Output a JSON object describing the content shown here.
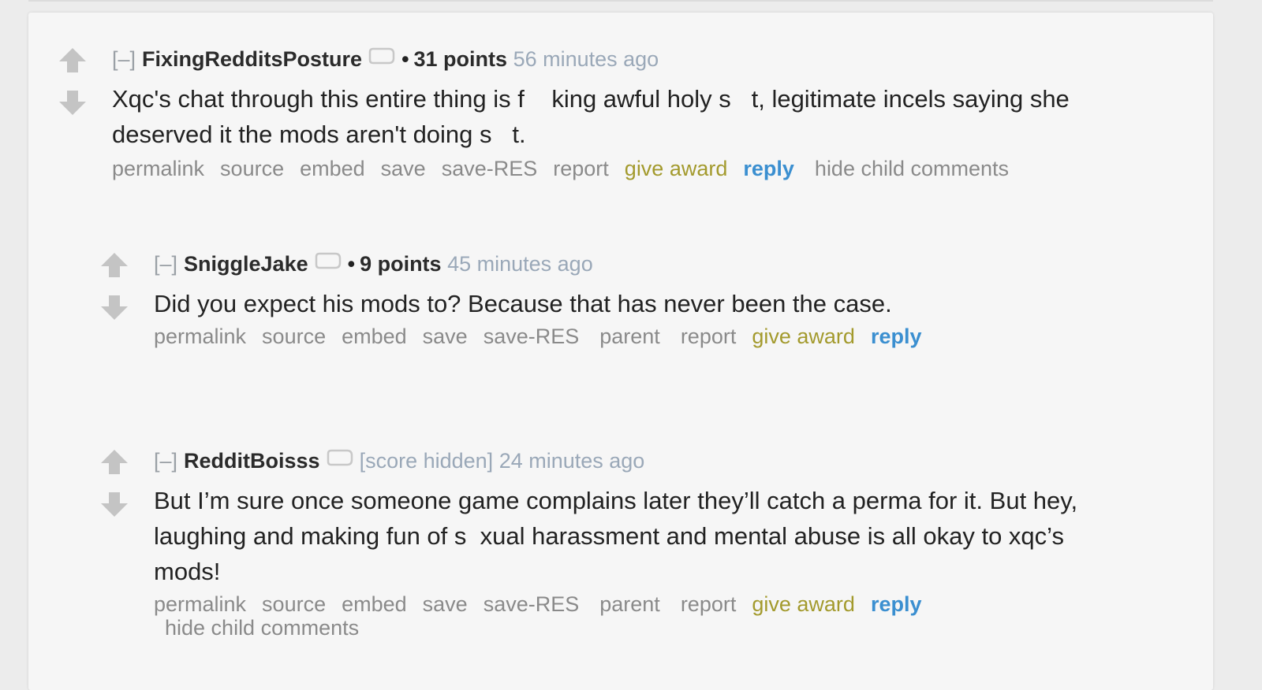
{
  "comments": [
    {
      "expand": "[–]",
      "author": "FixingRedditsPosture",
      "bullet": "•",
      "score": "31 points",
      "time": "56 minutes ago",
      "body": "Xqc's chat through this entire thing is f    king awful holy s   t, legitimate incels saying she deserved it the mods aren't doing s   t.",
      "buttons": {
        "permalink": "permalink",
        "source": "source",
        "embed": "embed",
        "save": "save",
        "save_res": "save-RES",
        "report": "report",
        "give_award": "give award",
        "reply": "reply",
        "hide_child": "hide child comments"
      }
    },
    {
      "expand": "[–]",
      "author": "SniggleJake",
      "bullet": "•",
      "score": "9 points",
      "time": "45 minutes ago",
      "body": "Did you expect his mods to? Because that has never been the case.",
      "buttons": {
        "permalink": "permalink",
        "source": "source",
        "embed": "embed",
        "save": "save",
        "save_res": "save-RES",
        "parent": "parent",
        "report": "report",
        "give_award": "give award",
        "reply": "reply"
      }
    },
    {
      "expand": "[–]",
      "author": "RedditBoisss",
      "score_hidden": "[score hidden]",
      "time": "24 minutes ago",
      "body": "But I’m sure once someone game complains later they’ll catch a perma for it. But hey, laughing and making fun of s  xual harassment and mental abuse is all okay to xqc’s mods!",
      "buttons": {
        "permalink": "permalink",
        "source": "source",
        "embed": "embed",
        "save": "save",
        "save_res": "save-RES",
        "parent": "parent",
        "report": "report",
        "give_award": "give award",
        "reply": "reply",
        "hide_child": "hide child comments"
      }
    }
  ],
  "icons": {
    "upvote": "upvote-arrow-icon",
    "downvote": "downvote-arrow-icon",
    "flair": "tag-icon"
  },
  "colors": {
    "award": "#a39a2d",
    "reply": "#3b8fd0",
    "time": "#9aa8b8",
    "buttons": "#8a8a8a"
  }
}
